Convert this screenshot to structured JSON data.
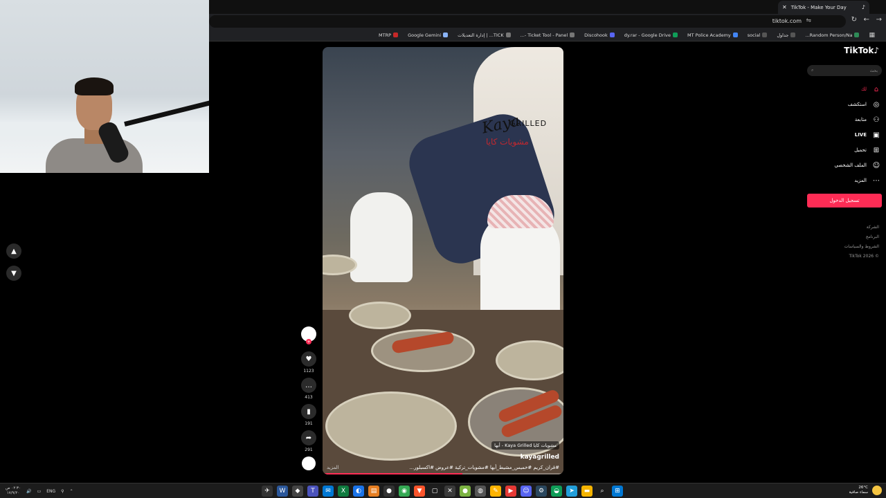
{
  "browser": {
    "tab_title": "TikTok - Make Your Day",
    "url": "tiktok.com",
    "bookmarks": [
      "MTRP",
      "Google Gemini",
      "TICK... | إدارة التعديلات",
      "Ticket Tool - Panel -...",
      "Discohook",
      "dy.rar - Google Drive",
      "MT Police Academy",
      "social",
      "جداول",
      "Random Person/Na..."
    ]
  },
  "video": {
    "logo_text": "Kaya",
    "logo_sub": "GRILLED",
    "logo_ar": "مشويات كايا",
    "place_tag": "مشويات كايا Kaya Grilled - أبها",
    "author": "kayagrilled",
    "tags": "#قران_كريم #خميس_مشيط_أبها #مشويات_تركية #عروض #اكسبلور...",
    "more_label": "المزيد",
    "progress": 0.58
  },
  "actions": {
    "likes": "1123",
    "comments": "413",
    "saves": "191",
    "shares": "291"
  },
  "sidebar": {
    "logo": "TikTok",
    "search_placeholder": "بحث",
    "items": [
      "لك",
      "استكشف",
      "متابعة",
      "LIVE",
      "تحميل",
      "الملف الشخصي",
      "المزيد"
    ],
    "login_label": "تسجيل الدخول",
    "footer": [
      "الشركة",
      "البرنامج",
      "الشروط والسياسات",
      "© TikTok 2026"
    ]
  },
  "taskbar": {
    "time": "٠٢:٣٠ ص",
    "date": "١٧/٩/٢٠",
    "lang": "ENG",
    "temp": "26°C",
    "weather": "سماء صافية"
  },
  "colors": {
    "accent": "#fe2c55",
    "background": "#000000"
  }
}
